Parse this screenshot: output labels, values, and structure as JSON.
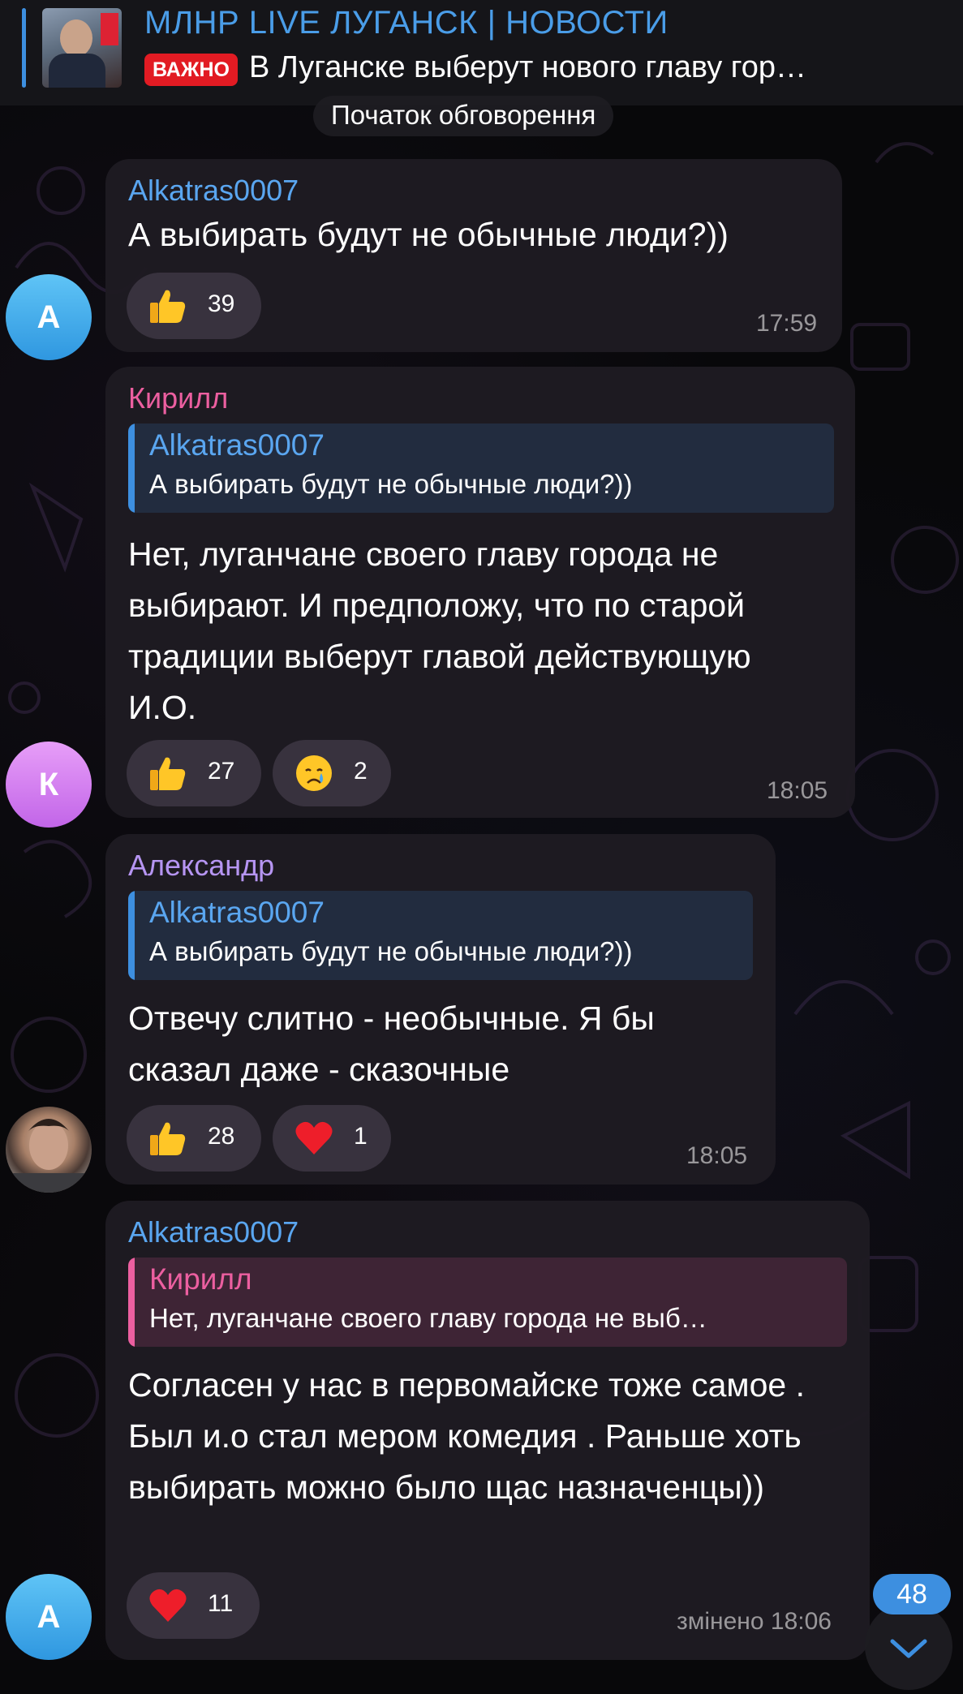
{
  "pinned": {
    "channel_title": "МЛНР LIVE ЛУГАНСК | НОВОСТИ",
    "badge": "ВАЖНО",
    "preview": "В Луганске выберут нового главу гор…"
  },
  "discussion_start": "Початок обговорення",
  "colors": {
    "accent": "#3d8fe0",
    "badge_red": "#e21b23",
    "author_blue": "#5aa6f0",
    "author_pink": "#ec5fa0",
    "author_violet": "#b695f2"
  },
  "messages": [
    {
      "avatar_letter": "А",
      "author": "Alkatras0007",
      "text": "А выбирать будут не обычные люди?))",
      "reactions": [
        {
          "emoji": "thumbs-up",
          "count": "39"
        }
      ],
      "time": "17:59"
    },
    {
      "avatar_letter": "К",
      "author": "Кирилл",
      "reply_author": "Alkatras0007",
      "reply_text": "А выбирать будут не обычные люди?))",
      "text": "Нет, луганчане своего главу города не выбирают. И предположу,  что по старой традиции выберут главой действующую И.О.",
      "reactions": [
        {
          "emoji": "thumbs-up",
          "count": "27"
        },
        {
          "emoji": "crying-face",
          "count": "2"
        }
      ],
      "time": "18:05"
    },
    {
      "author": "Александр",
      "reply_author": "Alkatras0007",
      "reply_text": "А выбирать будут не обычные люди?))",
      "text": "Отвечу слитно - необычные. Я бы сказал даже - сказочные",
      "reactions": [
        {
          "emoji": "thumbs-up",
          "count": "28"
        },
        {
          "emoji": "red-heart",
          "count": "1"
        }
      ],
      "time": "18:05"
    },
    {
      "avatar_letter": "А",
      "author": "Alkatras0007",
      "reply_author": "Кирилл",
      "reply_text": "Нет, луганчане своего главу города не выб…",
      "text": "Согласен у нас в первомайске тоже самое . Был и.о стал мером комедия . Раньше хоть выбирать можно было щас назначенцы))",
      "reactions": [
        {
          "emoji": "red-heart",
          "count": "11"
        }
      ],
      "time": "змінено 18:06"
    }
  ],
  "unread_count": "48"
}
